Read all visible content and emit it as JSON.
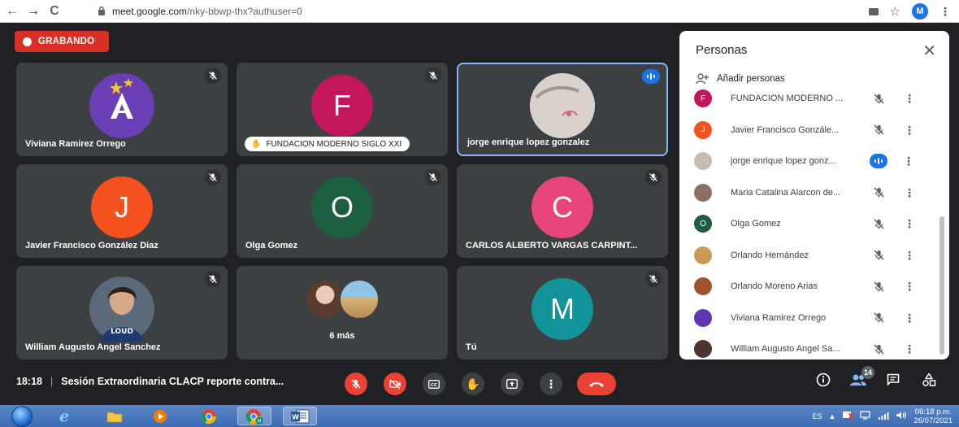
{
  "browser": {
    "url_host": "meet.google.com",
    "url_path": "/nky-bbwp-thx?authuser=0",
    "profile_initial": "M"
  },
  "recording": {
    "label": "GRABANDO"
  },
  "tiles": [
    {
      "name": "Viviana Ramirez Orrego",
      "avatar_type": "logo",
      "muted": true
    },
    {
      "name": "FUNDACION MODERNO SIGLO XXI",
      "avatar_type": "letter",
      "letter": "F",
      "color": "#c2185b",
      "muted": true,
      "hand_raised": true
    },
    {
      "name": "jorge enrique lopez gonzalez",
      "avatar_type": "photo",
      "speaking": true
    },
    {
      "name": "Javier Francisco González Diaz",
      "avatar_type": "letter",
      "letter": "J",
      "color": "#f4511e",
      "muted": true
    },
    {
      "name": "Olga Gomez",
      "avatar_type": "letter",
      "letter": "O",
      "color": "#1b5e40",
      "muted": true
    },
    {
      "name": "CARLOS ALBERTO VARGAS CARPINT...",
      "avatar_type": "letter",
      "letter": "C",
      "color": "#e8457a",
      "muted": true
    },
    {
      "name": "William Augusto Angel Sanchez",
      "avatar_type": "photo",
      "muted": true
    },
    {
      "name": "6 más",
      "avatar_type": "group"
    },
    {
      "name": "Tú",
      "avatar_type": "letter",
      "letter": "M",
      "color": "#12939a",
      "muted": true
    }
  ],
  "meeting": {
    "time": "18:18",
    "title": "Sesión Extraordinaria CLACP reporte contra..."
  },
  "people_count": "14",
  "panel": {
    "title": "Personas",
    "add_label": "Añadir personas",
    "people": [
      {
        "name": "FUNDACION MODERNO ...",
        "avatar": "letter",
        "letter": "F",
        "color": "#c2185b",
        "status": "muted"
      },
      {
        "name": "Javier Francisco Gonzále...",
        "avatar": "letter",
        "letter": "J",
        "color": "#f4511e",
        "status": "muted"
      },
      {
        "name": "jorge enrique lopez gonz...",
        "avatar": "photo",
        "color": "#c7bcb4",
        "status": "speaking"
      },
      {
        "name": "Maria Catalina Alarcon de...",
        "avatar": "photo",
        "color": "#8d6e63",
        "status": "muted"
      },
      {
        "name": "Olga Gomez",
        "avatar": "letter",
        "letter": "O",
        "color": "#1b5e40",
        "status": "muted"
      },
      {
        "name": "Orlando Hernández",
        "avatar": "photo",
        "color": "#c79a5a",
        "status": "muted"
      },
      {
        "name": "Orlando Moreno Arias",
        "avatar": "photo",
        "color": "#a0522d",
        "status": "muted"
      },
      {
        "name": "Viviana Ramirez Orrego",
        "avatar": "photo",
        "color": "#5e35b1",
        "status": "muted"
      },
      {
        "name": "William Augusto Angel Sa...",
        "avatar": "photo",
        "color": "#4e342e",
        "status": "muted"
      }
    ]
  },
  "taskbar": {
    "language": "ES",
    "time": "06:18 p.m.",
    "date": "26/07/2021"
  }
}
